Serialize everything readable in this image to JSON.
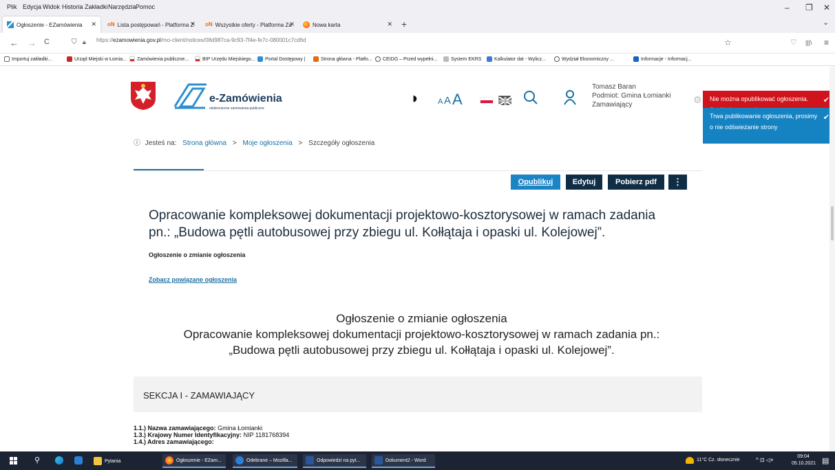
{
  "menubar": {
    "items": [
      "Plik",
      "Edycja",
      "Widok",
      "Historia",
      "Zakładki",
      "Narzędzia",
      "Pomoc"
    ],
    "minimize": "–",
    "restore": "❐",
    "close": "✕"
  },
  "tabs": [
    {
      "label": "Ogłoszenie - EZamówienia",
      "close": "✕"
    },
    {
      "label": "Lista postępowań - Platforma Z",
      "close": "✕"
    },
    {
      "label": "Wszystkie oferty - Platforma Za",
      "close": "✕"
    },
    {
      "label": "Nowa karta",
      "close": "✕"
    }
  ],
  "tab_new": "+",
  "tab_list": "⌄",
  "nav": {
    "back": "←",
    "forward": "→",
    "reload": "C",
    "url_prefix": "https://",
    "url_domain": "ezamowienia.gov.pl",
    "url_path": "/mo-client/notices/08d987ca-9c93-7f4e-fe7c-080001c7cd6d",
    "star": "☆",
    "pocket": "♡",
    "library": "|||\\",
    "menu": "≡"
  },
  "bookmarks": [
    "Importuj zakładki...",
    "Urząd Miejski w Łomia...",
    "Zamówienia publiczne...",
    "BIP Urzędu Miejskiego...",
    "Portal Dostępowy |",
    "Strona główna - Platfo...",
    "CEIDG – Przed wypełni...",
    "System EKRS",
    "Kalkulator dat - Wylicz...",
    "Wydział Ekonomiczny ...",
    "Informacje - Informacj..."
  ],
  "site": {
    "logo_title": "e-Zamówienia",
    "logo_sub": "elektroniczne zamówienia publiczne",
    "contrast_icon": "◑",
    "font_small": "A",
    "font_mid": "A",
    "font_big": "A",
    "user_name": "Tomasz Baran",
    "user_entity": "Podmiot: Gmina Łomianki",
    "user_role": "Zamawiający"
  },
  "breadcrumb": {
    "info": "ⓘ",
    "prefix": "Jesteś na:",
    "home": "Strona główna",
    "sep1": ">",
    "my": "Moje ogłoszenia",
    "sep2": ">",
    "current": "Szczegóły ogłoszenia"
  },
  "actions": {
    "publish": "Opublikuj",
    "edit": "Edytuj",
    "pdf": "Pobierz pdf",
    "more": "⋮"
  },
  "notice": {
    "title_line1": "Opracowanie kompleksowej dokumentacji projektowo-kosztorysowej w ramach zadania",
    "title_line2": "pn.: „Budowa pętli autobusowej przy zbiegu ul. Kołłątaja i opaski ul. Kolejowej”.",
    "type": "Ogłoszenie o zmianie ogłoszenia",
    "related": "Zobacz powiązane ogłoszenia",
    "doc_heading": "Ogłoszenie o zmianie ogłoszenia",
    "doc_line1": "Opracowanie kompleksowej dokumentacji projektowo-kosztorysowej w ramach zadania pn.:",
    "doc_line2": "„Budowa pętli autobusowej przy zbiegu ul. Kołłątaja i opaski ul. Kolejowej”.",
    "section1": "SEKCJA I - ZAMAWIAJĄCY",
    "field1_label": "1.1.) Nazwa zamawiającego:",
    "field1_value": "Gmina Łomianki",
    "field2_label": "1.3.) Krajowy Numer Identyfikacyjny:",
    "field2_value": "NIP 1181768394",
    "field3_label": "1.4.) Adres zamawiającego:"
  },
  "toasts": {
    "error": "Nie można opublikować ogłoszenia. Spróbuj ponownie",
    "info": "Trwa publikowanie ogłoszenia, prosimy o nie odświeżanie strony",
    "check": "✔"
  },
  "taskbar": {
    "items": [
      "Pytania",
      "Ogłoszenie - EZam...",
      "Odebrane – Mozilla...",
      "Odpowiedzi na pyt...",
      "Dokument2 - Word"
    ],
    "weather": "11°C  Cz. słonecznie",
    "tray": "^  ⊡  ◁×",
    "time": "09:04",
    "date": "05.10.2021",
    "notif": "▤"
  },
  "colors": {
    "publish_btn": "#1b84c4",
    "dark_btn": "#0f2d45",
    "link": "#1a6fa3",
    "error_toast": "#d0141d",
    "info_toast": "#1583c2",
    "section_bg": "#f2f2f2"
  }
}
